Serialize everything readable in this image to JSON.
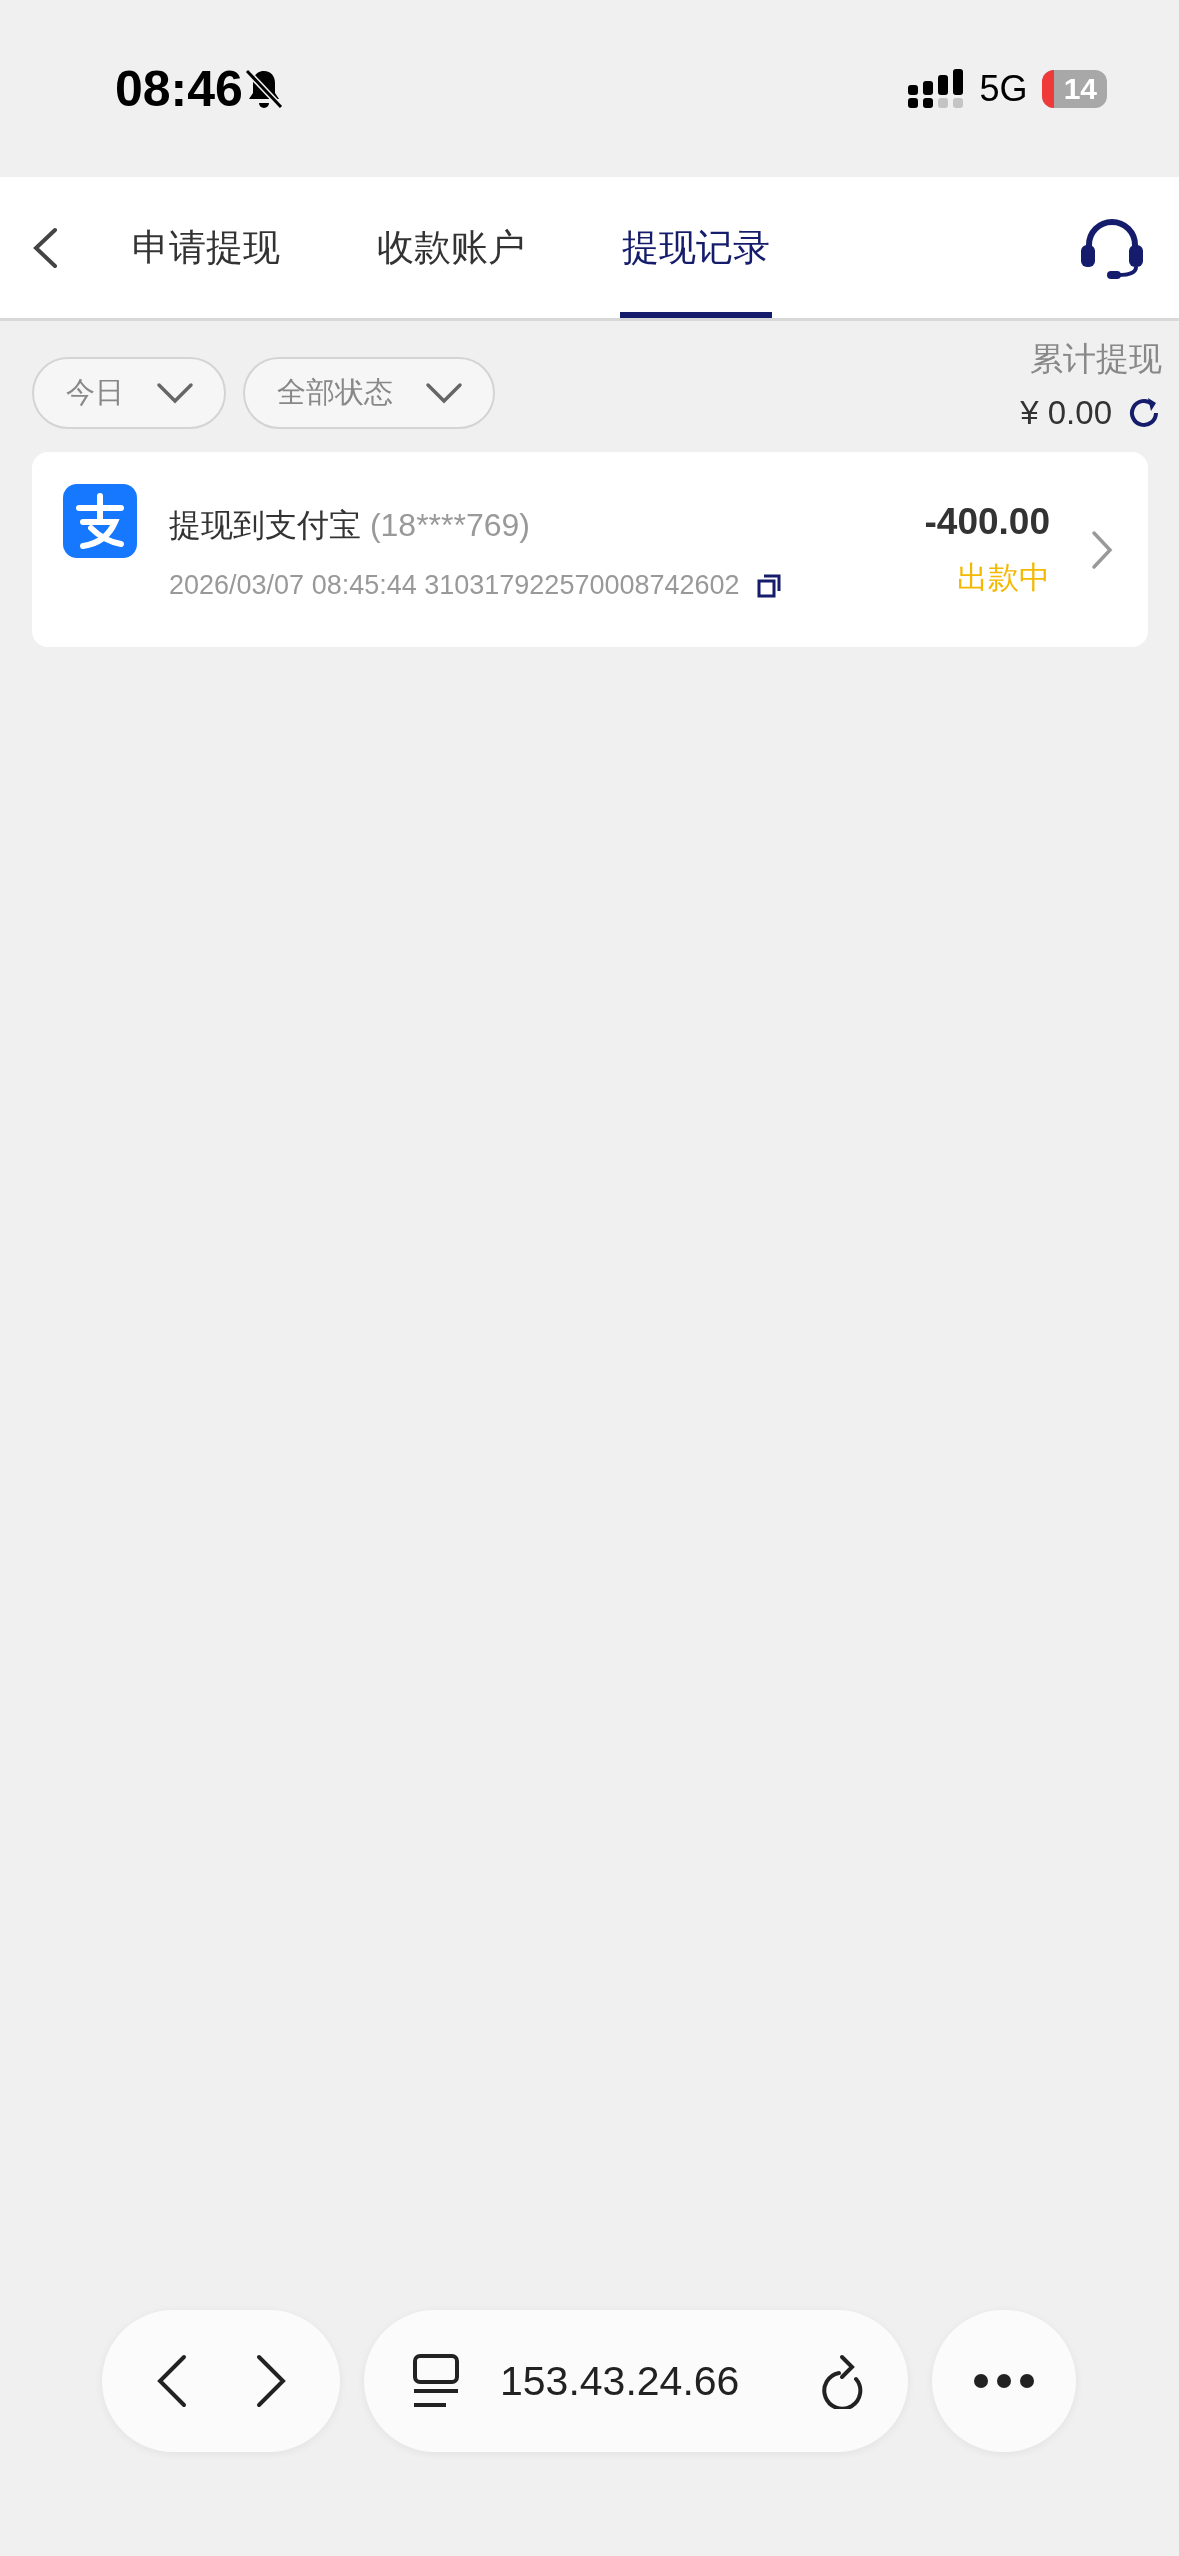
{
  "status_bar": {
    "time": "08:46",
    "network": "5G",
    "battery": "14"
  },
  "tabs": [
    {
      "label": "申请提现",
      "selected": false
    },
    {
      "label": "收款账户",
      "selected": false
    },
    {
      "label": "提现记录",
      "selected": true
    }
  ],
  "filters": [
    {
      "label": "今日"
    },
    {
      "label": "全部状态"
    }
  ],
  "summary": {
    "label": "累计提现",
    "amount": "¥ 0.00"
  },
  "records": [
    {
      "title": "提现到支付宝",
      "account": "(18****769)",
      "datetime": "2026/03/07 08:45:44",
      "order_no": "310317922570008742602",
      "amount": "-400.00",
      "status": "出款中"
    }
  ],
  "browser_bar": {
    "address": "153.43.24.66"
  }
}
